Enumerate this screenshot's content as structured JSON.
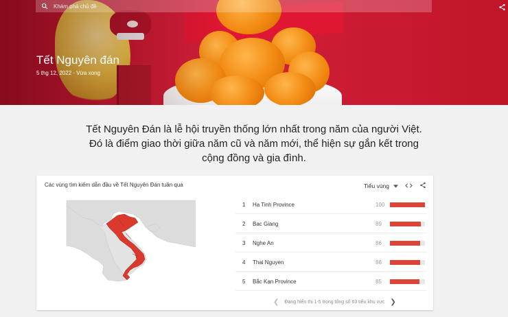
{
  "search": {
    "placeholder": "Khám phá chủ đề"
  },
  "hero": {
    "title": "Tết Nguyên đán",
    "date": "5 thg 12, 2022",
    "separator": " · ",
    "status": "Vừa xong"
  },
  "description": "Tết Nguyên Đán là lễ hội truyền thống lớn nhất trong năm của người Việt. Đó là điểm giao thời giữa năm cũ và năm mới, thể hiện sự gắn kết trong cộng đồng và gia đình.",
  "card": {
    "title": "Các vùng tìm kiếm dẫn đầu về Tết Nguyên Đán tuần qua",
    "resolution_label": "Tiểu vùng",
    "rows": [
      {
        "rank": "1",
        "name": "Ha Tinh Province",
        "value": "100",
        "score": 100
      },
      {
        "rank": "2",
        "name": "Bac Giang",
        "value": "89",
        "score": 89
      },
      {
        "rank": "3",
        "name": "Nghe An",
        "value": "86",
        "score": 86
      },
      {
        "rank": "4",
        "name": "Thai Nguyen",
        "value": "86",
        "score": 86
      },
      {
        "rank": "5",
        "name": "Bắc Kạn Province",
        "value": "85",
        "score": 85
      }
    ],
    "pager_text": "Đang hiển thị 1-5 trong tổng số 63 tiểu khu vực"
  },
  "colors": {
    "accent": "#db4437",
    "hero": "#c4142c",
    "map_highlight": "#d93a2d"
  }
}
